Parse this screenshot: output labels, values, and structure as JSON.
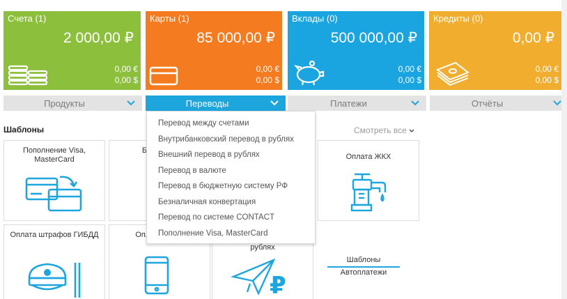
{
  "tiles": [
    {
      "title": "Счета (1)",
      "amount": "2 000,00 ₽",
      "eur": "0,00 €",
      "usd": "0,00 $",
      "color": "#8bbf3c",
      "icon": "coins-icon"
    },
    {
      "title": "Карты (1)",
      "amount": "85 000,00 ₽",
      "eur": "0,00 €",
      "usd": "0,00 $",
      "color": "#f47b20",
      "icon": "card-icon"
    },
    {
      "title": "Вклады (0)",
      "amount": "500 000,00 ₽",
      "eur": "0,00 €",
      "usd": "0,00 $",
      "color": "#1aa4e0",
      "icon": "piggy-bank-icon"
    },
    {
      "title": "Кредиты (0)",
      "amount": "0,00 ₽",
      "eur": "0,00 €",
      "usd": "0,00 $",
      "color": "#f0ad2e",
      "icon": "money-stack-icon"
    }
  ],
  "tabs": [
    {
      "label": "Продукты",
      "active": false
    },
    {
      "label": "Переводы",
      "active": true
    },
    {
      "label": "Платежи",
      "active": false
    },
    {
      "label": "Отчёты",
      "active": false
    }
  ],
  "section_title": "Шаблоны",
  "see_all": "Смотреть все",
  "dropdown_items": [
    "Перевод между счетами",
    "Внутрибанковский перевод в рублях",
    "Внешний перевод в рублях",
    "Перевод в валюте",
    "Перевод в бюджетную систему РФ",
    "Безналичная конвертация",
    "Перевод по системе CONTACT",
    "Пополнение Visa, MasterCard"
  ],
  "cards": [
    {
      "label": "Пополнение Visa, MasterCard",
      "icon": "card-transfer-icon"
    },
    {
      "label": "Безн конв",
      "icon": "currency-icon"
    },
    {
      "label": "Оплата ЖКХ",
      "icon": "faucet-icon"
    },
    {
      "label": "Оплата штрафов ГИБДД",
      "icon": "police-cap-icon"
    },
    {
      "label": "Оплата связи",
      "icon": "phone-icon"
    },
    {
      "label": "рублях",
      "icon": "paper-plane-ruble-icon"
    }
  ],
  "links": {
    "templates": "Шаблоны",
    "autopay": "Автоплатежи"
  },
  "colors": {
    "accent": "#1da5dd",
    "tab_inactive": "#e3e3e3"
  }
}
